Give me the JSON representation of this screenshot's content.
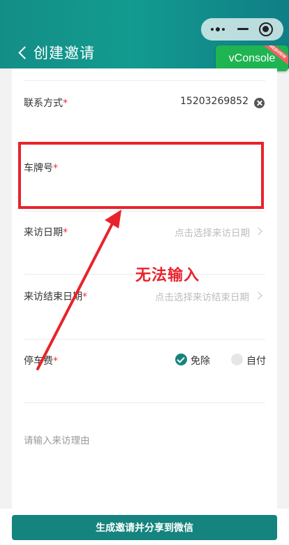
{
  "header": {
    "title": "创建邀请",
    "vconsole_label": "vConsole",
    "vconsole_ribbon": "WEBVIEW"
  },
  "form": {
    "contact": {
      "label": "联系方式",
      "required_mark": "*",
      "value": "15203269852"
    },
    "plate": {
      "label": "车牌号",
      "required_mark": "*",
      "value": ""
    },
    "visit_date": {
      "label": "来访日期",
      "required_mark": "*",
      "placeholder": "点击选择来访日期"
    },
    "visit_end_date": {
      "label": "来访结束日期",
      "required_mark": "*",
      "placeholder": "点击选择来访结束日期"
    },
    "parking_fee": {
      "label": "停车费",
      "required_mark": "*",
      "options": [
        {
          "label": "免除",
          "selected": true
        },
        {
          "label": "自付",
          "selected": false
        }
      ]
    },
    "reason": {
      "placeholder": "请输入来访理由"
    }
  },
  "annotation": {
    "text": "无法输入",
    "color": "#e8232b"
  },
  "footer": {
    "submit_label": "生成邀请并分享到微信"
  },
  "colors": {
    "accent": "#15837e",
    "header": "#139b90",
    "required": "#e5303c",
    "vconsole": "#1fb452"
  }
}
